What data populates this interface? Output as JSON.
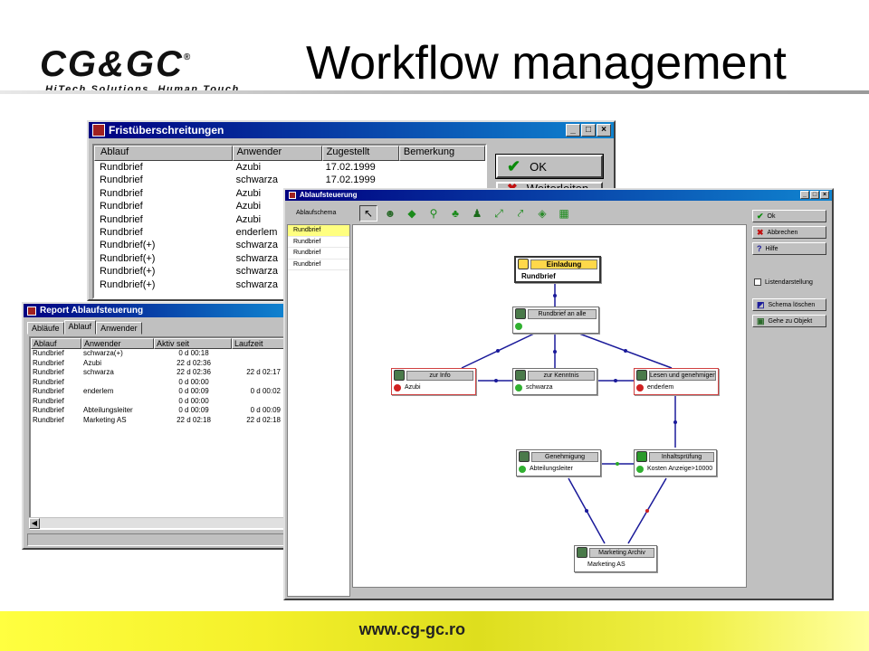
{
  "header": {
    "logo_text": "CG&GC",
    "logo_tagline": "HiTech Solutions, Human Touch",
    "title": "Workflow management"
  },
  "footer": {
    "url": "www.cg-gc.ro"
  },
  "frist_window": {
    "title": "Fristüberschreitungen",
    "columns": [
      "Ablauf",
      "Anwender",
      "Zugestellt",
      "Bemerkung"
    ],
    "rows": [
      [
        "Rundbrief",
        "Azubi",
        "17.02.1999",
        ""
      ],
      [
        "Rundbrief",
        "schwarza",
        "17.02.1999",
        ""
      ],
      [
        "Rundbrief",
        "Azubi",
        "",
        ""
      ],
      [
        "Rundbrief",
        "Azubi",
        "",
        ""
      ],
      [
        "Rundbrief",
        "Azubi",
        "",
        ""
      ],
      [
        "Rundbrief",
        "enderlem",
        "",
        ""
      ],
      [
        "Rundbrief(+)",
        "schwarza",
        "",
        ""
      ],
      [
        "Rundbrief(+)",
        "schwarza",
        "",
        ""
      ],
      [
        "Rundbrief(+)",
        "schwarza",
        "",
        ""
      ],
      [
        "Rundbrief(+)",
        "schwarza",
        "",
        ""
      ]
    ],
    "ok_label": "OK",
    "second_button_label": "Weiterleiten"
  },
  "report_window": {
    "title": "Report Ablaufsteuerung",
    "tabs": [
      "Abläufe",
      "Ablauf",
      "Anwender"
    ],
    "active_tab": "Ablauf",
    "columns": [
      "Ablauf",
      "Anwender",
      "Aktiv seit",
      "Laufzeit"
    ],
    "rows": [
      [
        "Rundbrief",
        "schwarza(+)",
        "0 d 00:18",
        ""
      ],
      [
        "Rundbrief",
        "Azubi",
        "22 d 02:36",
        ""
      ],
      [
        "Rundbrief",
        "schwarza",
        "22 d 02:36",
        "22 d 02:17"
      ],
      [
        "Rundbrief",
        "",
        "0 d 00:00",
        ""
      ],
      [
        "Rundbrief",
        "enderlem",
        "0 d 00:09",
        "0 d 00:02"
      ],
      [
        "Rundbrief",
        "",
        "0 d 00:00",
        ""
      ],
      [
        "Rundbrief",
        "Abteilungsleiter",
        "0 d 00:09",
        "0 d 00:09"
      ],
      [
        "Rundbrief",
        "Marketing AS",
        "22 d 02:18",
        "22 d 02:18"
      ]
    ]
  },
  "ablauf_window": {
    "title": "Ablaufsteuerung",
    "schema_label": "Ablaufschema",
    "schema_items": [
      "Rundbrief",
      "Rundbrief",
      "Rundbrief",
      "Rundbrief"
    ],
    "buttons": {
      "ok": "Ok",
      "abbrechen": "Abbrechen",
      "hilfe": "Hilfe",
      "listendarstellung": "Listendarstellung",
      "schema_loeschen": "Schema löschen",
      "gehe_zu_objekt": "Gehe zu Objekt"
    },
    "nodes": {
      "einladung": {
        "title": "Einladung",
        "value": "Rundbrief"
      },
      "rundbrief_an_alle": {
        "title": "Rundbrief an alle",
        "value": ""
      },
      "zur_info": {
        "title": "zur Info",
        "value": "Azubi"
      },
      "zur_kenntnis": {
        "title": "zur Kenntnis",
        "value": "schwarza"
      },
      "lesen": {
        "title": "Lesen und genehmigen",
        "value": "enderlem"
      },
      "genehmigung": {
        "title": "Genehmigung",
        "value": "Abteilungsleiter"
      },
      "inhaltspruefung": {
        "title": "Inhaltsprüfung",
        "value": "Kosten Anzeige>10000"
      },
      "marketing_archiv": {
        "title": "Marketing Archiv",
        "value": "Marketing AS"
      }
    }
  }
}
